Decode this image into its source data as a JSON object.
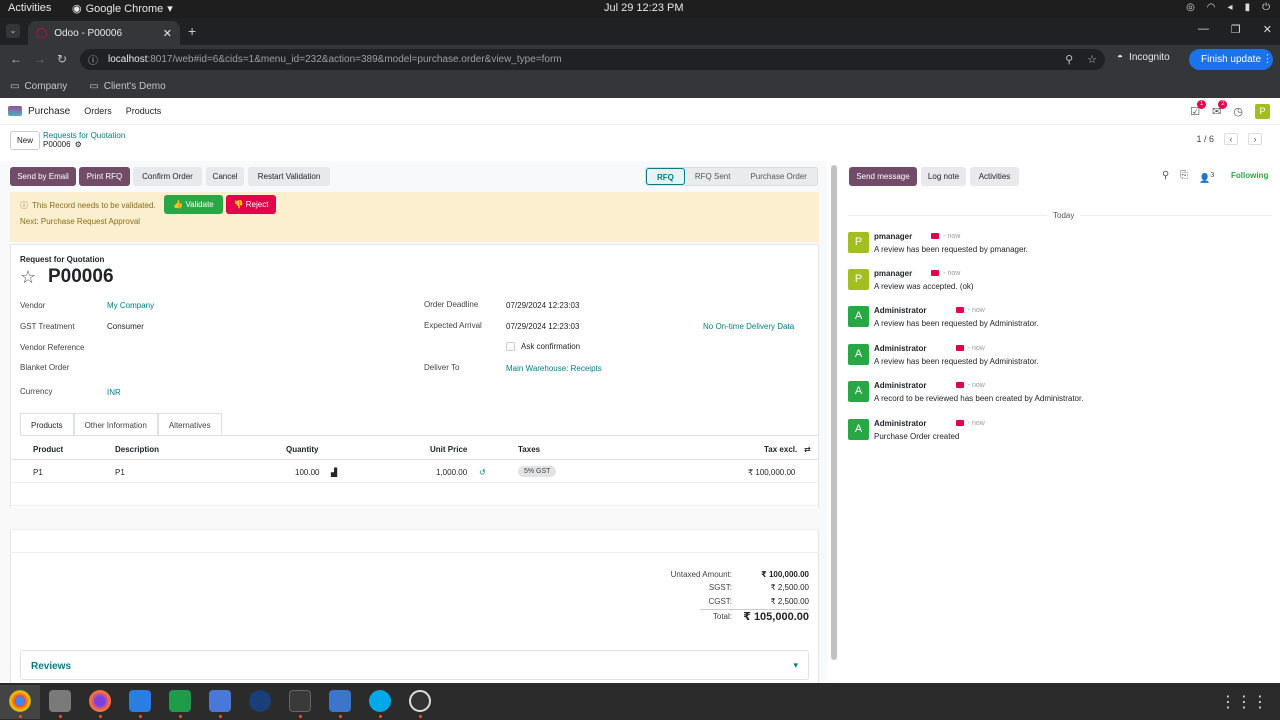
{
  "system": {
    "activities": "Activities",
    "app": "Google Chrome",
    "clock": "Jul 29  12:23 PM"
  },
  "browser": {
    "tab_title": "Odoo - P00006",
    "url_host": "localhost",
    "url_rest": ":8017/web#id=6&cids=1&menu_id=232&action=389&model=purchase.order&view_type=form",
    "incognito": "Incognito",
    "finish_update": "Finish update",
    "bookmarks": [
      "Company",
      "Client's Demo"
    ]
  },
  "navbar": {
    "app": "Purchase",
    "menus": [
      "Orders",
      "Products"
    ],
    "notif_count": "1",
    "chat_count": "2",
    "user_initial": "P"
  },
  "control": {
    "new_label": "New",
    "breadcrumb_parent": "Requests for Quotation",
    "breadcrumb_current": "P00006",
    "pager": "1 / 6"
  },
  "actions": {
    "send_email": "Send by Email",
    "print_rfq": "Print RFQ",
    "confirm": "Confirm Order",
    "cancel": "Cancel",
    "restart": "Restart Validation",
    "statuses": [
      "RFQ",
      "RFQ Sent",
      "Purchase Order"
    ],
    "active_status": "RFQ"
  },
  "alert": {
    "message": "This Record needs to be validated.",
    "validate": "Validate",
    "reject": "Reject",
    "next": "Next: Purchase Request Approval"
  },
  "form": {
    "doc_type": "Request for Quotation",
    "name": "P00006",
    "vendor_label": "Vendor",
    "vendor": "My Company",
    "gst_label": "GST Treatment",
    "gst": "Consumer",
    "vendor_ref_label": "Vendor Reference",
    "blanket_label": "Blanket Order",
    "currency_label": "Currency",
    "currency": "INR",
    "deadline_label": "Order Deadline",
    "deadline": "07/29/2024 12:23:03",
    "arrival_label": "Expected Arrival",
    "arrival": "07/29/2024 12:23:03",
    "ontime": "No On-time Delivery Data",
    "ask_confirmation": "Ask confirmation",
    "deliver_label": "Deliver To",
    "deliver": "Main Warehouse: Receipts"
  },
  "tabs": [
    "Products",
    "Other Information",
    "Alternatives"
  ],
  "table": {
    "headers": {
      "product": "Product",
      "description": "Description",
      "quantity": "Quantity",
      "unit_price": "Unit Price",
      "taxes": "Taxes",
      "tax_excl": "Tax excl."
    },
    "rows": [
      {
        "product": "P1",
        "description": "P1",
        "quantity": "100.00",
        "unit_price": "1,000.00",
        "taxes": "5% GST",
        "tax_excl": "₹ 100,000.00"
      }
    ]
  },
  "totals": {
    "untaxed_label": "Untaxed Amount:",
    "untaxed": "₹ 100,000.00",
    "sgst_label": "SGST:",
    "sgst": "₹ 2,500.00",
    "cgst_label": "CGST:",
    "cgst": "₹ 2,500.00",
    "total_label": "Total:",
    "total": "₹ 105,000.00"
  },
  "reviews": "Reviews",
  "chatter": {
    "send_message": "Send message",
    "log_note": "Log note",
    "activities": "Activities",
    "followers": "3",
    "following": "Following",
    "today": "Today",
    "messages": [
      {
        "author": "pmanager",
        "initial": "P",
        "color": "#a1c020",
        "time": "- now",
        "body": "A review has been requested by pmanager."
      },
      {
        "author": "pmanager",
        "initial": "P",
        "color": "#a1c020",
        "time": "- now",
        "body": "A review was accepted. (ok)"
      },
      {
        "author": "Administrator",
        "initial": "A",
        "color": "#28a745",
        "time": "- now",
        "body": "A review has been requested by Administrator."
      },
      {
        "author": "Administrator",
        "initial": "A",
        "color": "#28a745",
        "time": "- now",
        "body": "A review has been requested by Administrator."
      },
      {
        "author": "Administrator",
        "initial": "A",
        "color": "#28a745",
        "time": "- now",
        "body": "A record to be reviewed has been created by Administrator."
      },
      {
        "author": "Administrator",
        "initial": "A",
        "color": "#28a745",
        "time": "- now",
        "body": "Purchase Order created"
      }
    ]
  },
  "colors": {
    "primary": "#714b67",
    "link": "#017e84",
    "validate": "#28a745",
    "reject": "#e5004b"
  }
}
